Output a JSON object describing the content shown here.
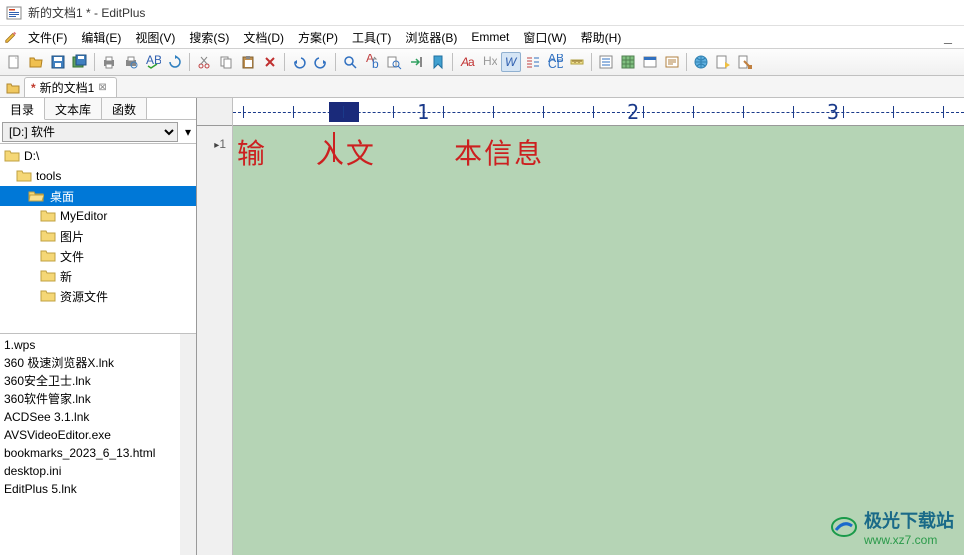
{
  "window": {
    "title": "新的文档1 * - EditPlus"
  },
  "menu": {
    "file": "文件(F)",
    "edit": "编辑(E)",
    "view": "视图(V)",
    "search": "搜索(S)",
    "doc": "文档(D)",
    "project": "方案(P)",
    "tool": "工具(T)",
    "browser": "浏览器(B)",
    "emmet": "Emmet",
    "window": "窗口(W)",
    "help": "帮助(H)"
  },
  "doctab": {
    "name": "新的文档1",
    "modified": "*",
    "close": "×"
  },
  "sidebar": {
    "tabs": {
      "dir": "目录",
      "lib": "文本库",
      "func": "函数"
    },
    "drive": "[D:] 软件",
    "tree": [
      "D:\\",
      "tools",
      "桌面",
      "MyEditor",
      "图片",
      "文件",
      "新",
      "资源文件"
    ],
    "files": [
      "1.wps",
      "360 极速浏览器X.lnk",
      "360安全卫士.lnk",
      "360软件管家.lnk",
      "ACDSee 3.1.lnk",
      "AVSVideoEditor.exe",
      "bookmarks_2023_6_13.html",
      "desktop.ini",
      "EditPlus 5.lnk"
    ]
  },
  "ruler": {
    "n1": "1",
    "n2": "2",
    "n3": "3"
  },
  "editor": {
    "line_no": "1",
    "text": "输     入文        本信息"
  },
  "watermark": {
    "cn": "极光下载站",
    "url": "www.xz7.com"
  }
}
